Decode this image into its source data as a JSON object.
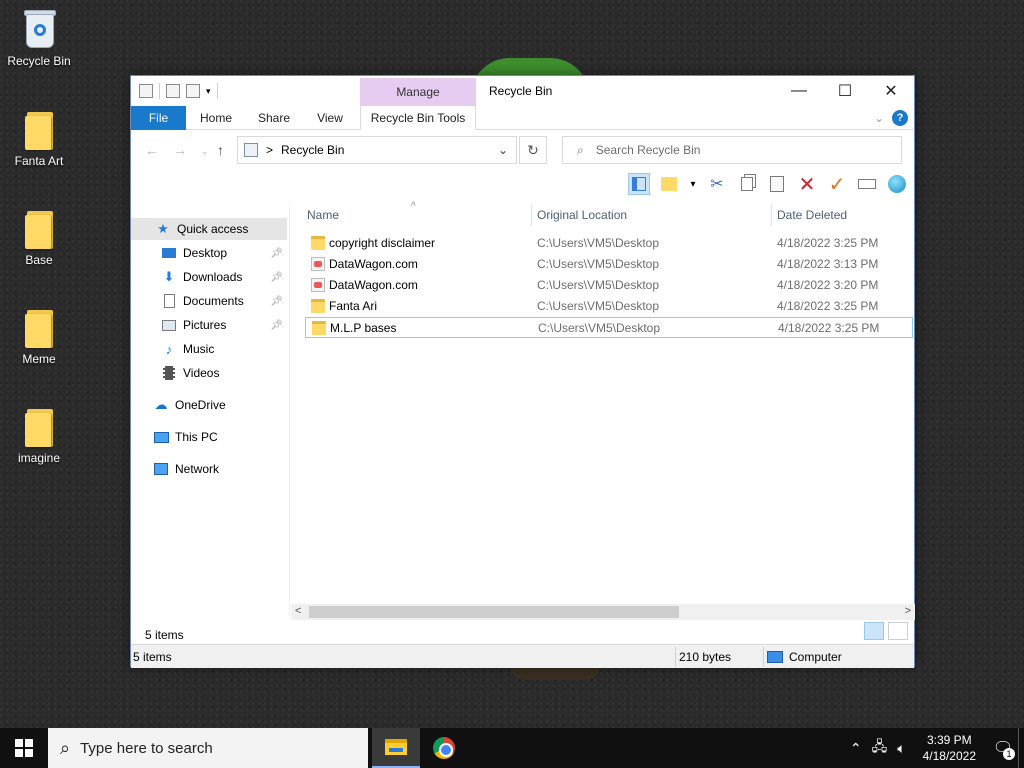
{
  "desktop": {
    "icons": [
      {
        "label": "Recycle Bin",
        "kind": "recycle-bin"
      },
      {
        "label": "Fanta Art",
        "kind": "folder"
      },
      {
        "label": "Base",
        "kind": "folder"
      },
      {
        "label": "Meme",
        "kind": "folder"
      },
      {
        "label": "imagine",
        "kind": "folder"
      }
    ]
  },
  "window": {
    "title": "Recycle Bin",
    "contextual_group": "Manage",
    "controls": {
      "minimize": "—",
      "maximize": "☐",
      "close": "✕"
    },
    "ribbon_tabs": {
      "file": "File",
      "home": "Home",
      "share": "Share",
      "view": "View",
      "recycle_bin_tools": "Recycle Bin Tools"
    },
    "address": {
      "separator": ">",
      "location": "Recycle Bin"
    },
    "search_placeholder": "Search Recycle Bin",
    "nav": {
      "quick_access": "Quick access",
      "desktop": "Desktop",
      "downloads": "Downloads",
      "documents": "Documents",
      "pictures": "Pictures",
      "music": "Music",
      "videos": "Videos",
      "onedrive": "OneDrive",
      "this_pc": "This PC",
      "network": "Network"
    },
    "columns": {
      "name": "Name",
      "original_location": "Original Location",
      "date_deleted": "Date Deleted"
    },
    "rows": [
      {
        "name": "copyright disclaimer",
        "kind": "folder",
        "location": "C:\\Users\\VM5\\Desktop",
        "date": "4/18/2022 3:25 PM"
      },
      {
        "name": "DataWagon.com",
        "kind": "file",
        "location": "C:\\Users\\VM5\\Desktop",
        "date": "4/18/2022 3:13 PM"
      },
      {
        "name": "DataWagon.com",
        "kind": "file",
        "location": "C:\\Users\\VM5\\Desktop",
        "date": "4/18/2022 3:20 PM"
      },
      {
        "name": "Fanta Ari",
        "kind": "folder",
        "location": "C:\\Users\\VM5\\Desktop",
        "date": "4/18/2022 3:25 PM"
      },
      {
        "name": "M.L.P bases",
        "kind": "folder",
        "location": "C:\\Users\\VM5\\Desktop",
        "date": "4/18/2022 3:25 PM"
      }
    ],
    "item_count": "5 items",
    "status": {
      "items": "5 items",
      "size": "210 bytes",
      "location": "Computer"
    }
  },
  "taskbar": {
    "search_placeholder": "Type here to search",
    "time": "3:39 PM",
    "date": "4/18/2022",
    "notification_count": "1"
  },
  "colors": {
    "accent": "#1979ca",
    "manage_tab": "#e6ccf0",
    "selection": "#cce4f7"
  }
}
